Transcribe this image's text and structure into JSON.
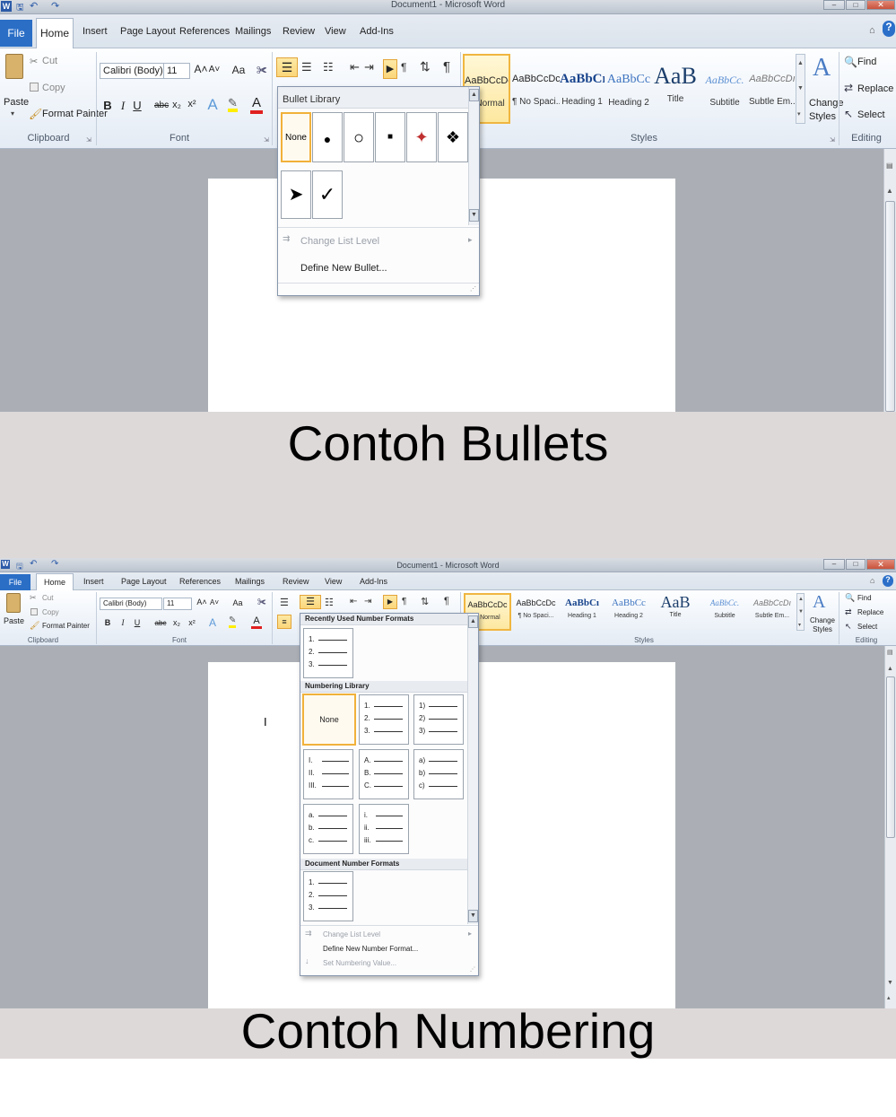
{
  "window": {
    "title": "Document1 - Microsoft Word",
    "qat": {
      "word_icon": "W",
      "save_icon": "save-icon",
      "undo_icon": "undo-icon",
      "redo_icon": "redo-icon"
    }
  },
  "tabs": [
    "File",
    "Home",
    "Insert",
    "Page Layout",
    "References",
    "Mailings",
    "Review",
    "View",
    "Add-Ins"
  ],
  "clipboard": {
    "paste": "Paste",
    "cut": "Cut",
    "copy": "Copy",
    "format_painter": "Format Painter",
    "group": "Clipboard"
  },
  "font": {
    "family": "Calibri (Body)",
    "size": "11",
    "group": "Font",
    "grow": "A˄",
    "shrink": "A˅",
    "case": "Aa",
    "bold": "B",
    "italic": "I",
    "underline": "U",
    "strike": "abc",
    "sub": "x₂",
    "sup": "x²",
    "effects": "A",
    "color": "A"
  },
  "styles": {
    "group": "Styles",
    "items": [
      {
        "preview": "AaBbCcDc",
        "name": "¶ Normal"
      },
      {
        "preview": "AaBbCcDc",
        "name": "¶ No Spaci..."
      },
      {
        "preview": "AaBbCı",
        "name": "Heading 1"
      },
      {
        "preview": "AaBbCc",
        "name": "Heading 2"
      },
      {
        "preview": "AaB",
        "name": "Title"
      },
      {
        "preview": "AaBbCc.",
        "name": "Subtitle"
      },
      {
        "preview": "AaBbCcDı",
        "name": "Subtle Em..."
      }
    ],
    "change": "Change Styles"
  },
  "editing": {
    "find": "Find",
    "replace": "Replace",
    "select": "Select",
    "group": "Editing"
  },
  "bullet_menu": {
    "header": "Bullet Library",
    "items": [
      "None",
      "●",
      "○",
      "■",
      "✦",
      "❖",
      "➤",
      "✓"
    ],
    "change_level": "Change List Level",
    "define": "Define New Bullet..."
  },
  "numbering_menu": {
    "recent_header": "Recently Used Number Formats",
    "library_header": "Numbering Library",
    "document_header": "Document Number Formats",
    "none": "None",
    "recent": [
      [
        "1.",
        "2.",
        "3."
      ]
    ],
    "library": [
      [
        "1.",
        "2.",
        "3."
      ],
      [
        "1)",
        "2)",
        "3)"
      ],
      [
        "I.",
        "II.",
        "III."
      ],
      [
        "A.",
        "B.",
        "C."
      ],
      [
        "a)",
        "b)",
        "c)"
      ],
      [
        "a.",
        "b.",
        "c."
      ],
      [
        "i.",
        "ii.",
        "iii."
      ]
    ],
    "document": [
      [
        "1.",
        "2.",
        "3."
      ]
    ],
    "change_level": "Change List Level",
    "define": "Define New Number Format...",
    "set_value": "Set Numbering Value..."
  },
  "captions": {
    "bullets": "Contoh Bullets",
    "numbering": "Contoh Numbering"
  },
  "cursor": "I",
  "colors": {
    "file_tab": "#2a6ec6",
    "selected": "#f1b13a",
    "workspace": "#abafb5",
    "caption_bg": "#ded9d9"
  }
}
